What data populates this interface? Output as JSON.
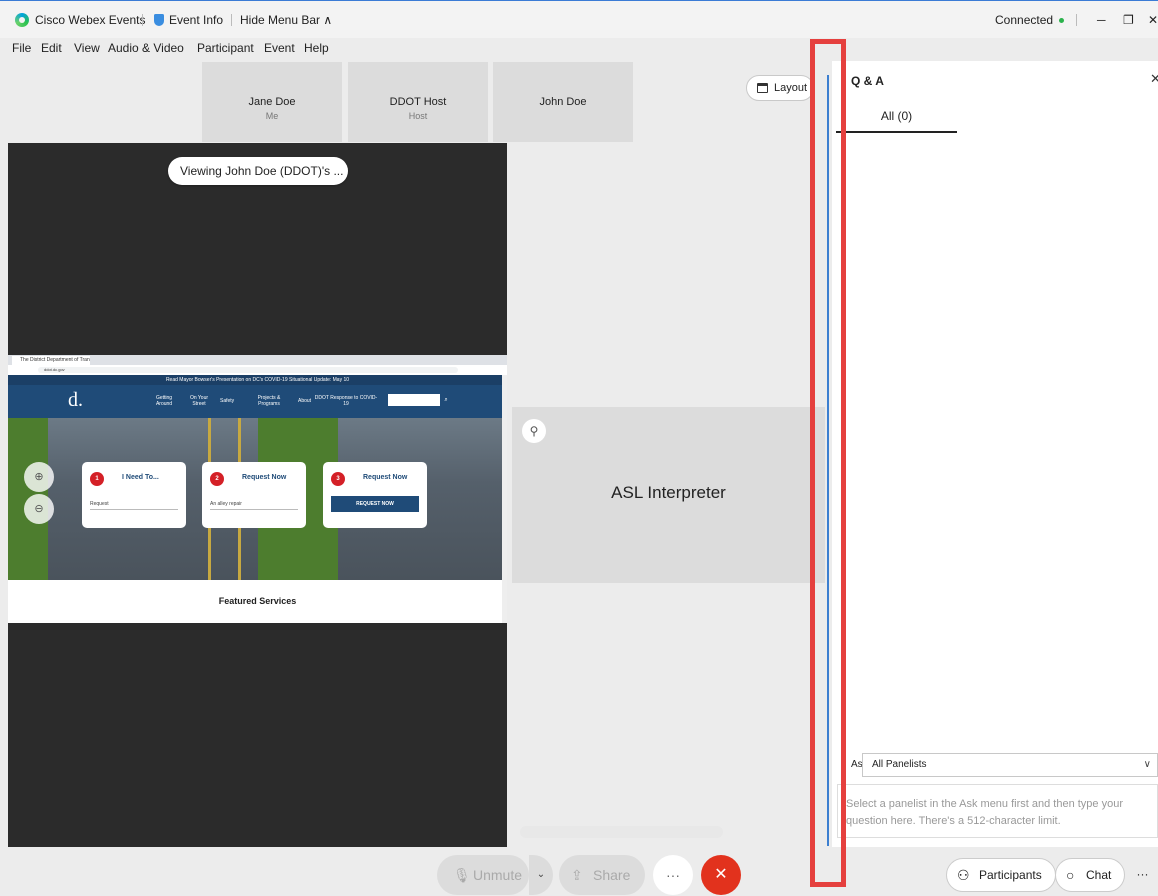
{
  "titlebar": {
    "app_name": "Cisco Webex Events",
    "event_info": "Event Info",
    "hide_menu": "Hide Menu Bar",
    "hide_menu_caret": "∧",
    "status": "Connected",
    "minimize": "─",
    "restore": "❐",
    "close": "✕"
  },
  "menu": [
    "File",
    "Edit",
    "View",
    "Audio & Video",
    "Participant",
    "Event",
    "Help"
  ],
  "participants": [
    {
      "name": "Jane Doe",
      "role": "Me"
    },
    {
      "name": "DDOT Host",
      "role": "Host"
    },
    {
      "name": "John Doe",
      "role": ""
    }
  ],
  "layout_button": "Layout",
  "viewing_label": "Viewing John Doe (DDOT)'s ...",
  "shared_screen": {
    "tab_title": "The District Department of Tran...",
    "url": "ddot.dc.gov",
    "banner": "Read Mayor Bowser's Presentation on DC's COVID-19 Situational Update: May 10",
    "logo": "d.",
    "nav": [
      "Getting Around",
      "On Your Street",
      "Safety",
      "Projects & Programs",
      "About",
      "DDOT Response to COVID-19"
    ],
    "cards": [
      {
        "num": "1",
        "title": "I Need To...",
        "field": "Request"
      },
      {
        "num": "2",
        "title": "Request Now",
        "field": "An alley repair"
      },
      {
        "num": "3",
        "title": "Request Now",
        "button": "REQUEST NOW"
      }
    ],
    "zoom_in": "⊕",
    "zoom_out": "⊖",
    "featured": "Featured Services"
  },
  "asl_tile": {
    "label": "ASL Interpreter",
    "pin": "⚲"
  },
  "toolbar": {
    "unmute": "Unmute",
    "share": "Share",
    "more": "···",
    "leave": "✕",
    "participants": "Participants",
    "chat": "Chat"
  },
  "qa": {
    "title": "Q & A",
    "tab_all": "All (0)",
    "ask_label": "Ask:",
    "ask_value": "All Panelists",
    "placeholder": "Select a panelist in the Ask menu first and then type your question here. There's a 512-character limit."
  },
  "colors": {
    "highlight": "#e5403e",
    "accent": "#3c7fd0",
    "leave": "#e2321d"
  }
}
